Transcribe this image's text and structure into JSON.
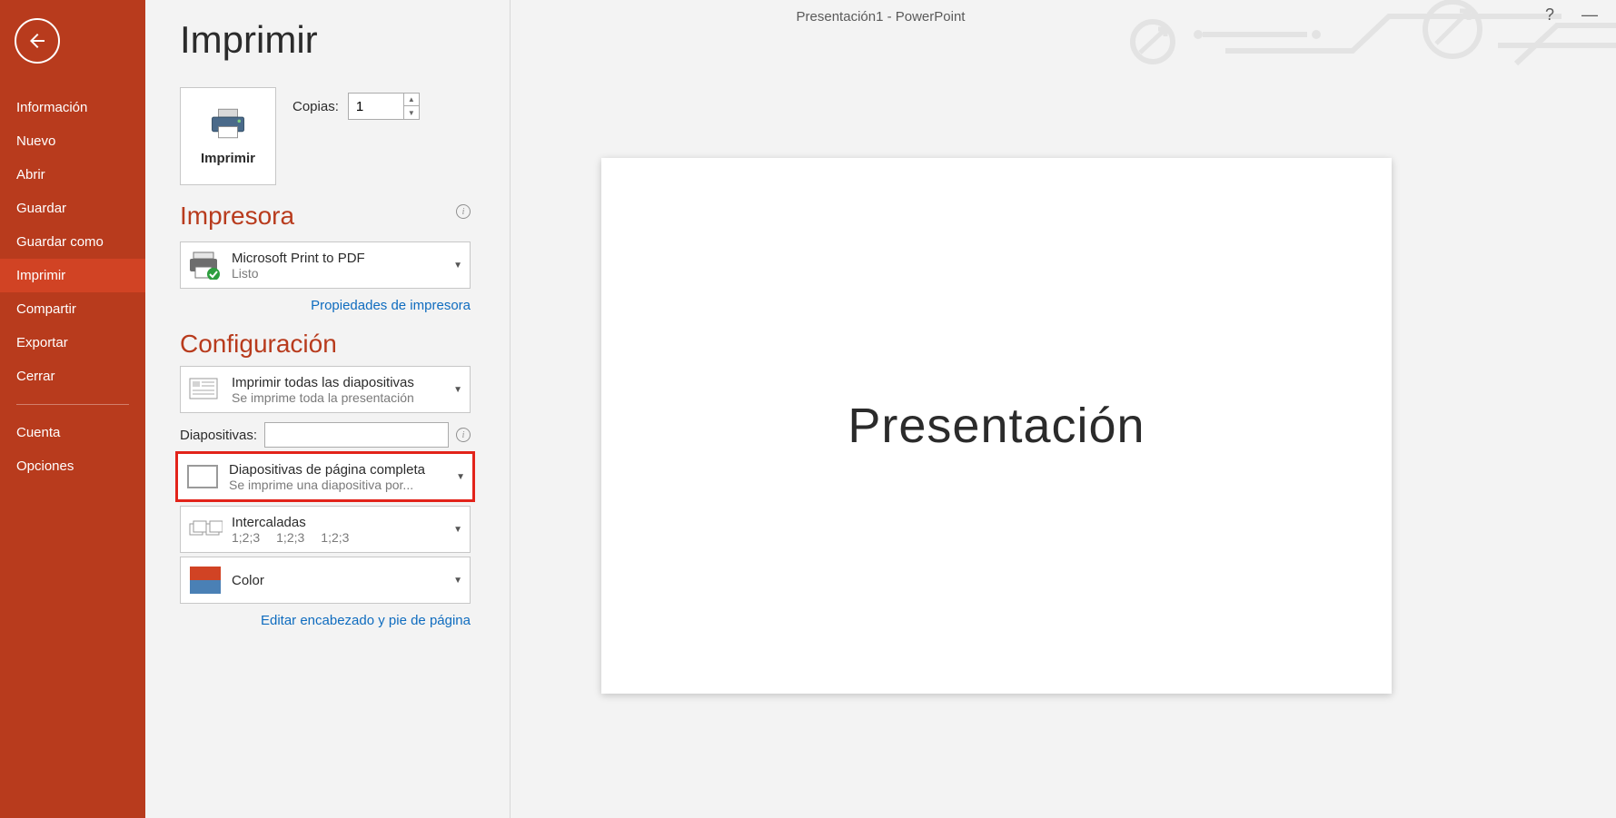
{
  "window": {
    "title": "Presentación1 - PowerPoint",
    "help": "?",
    "minimize": "—"
  },
  "sidebar": {
    "items": [
      {
        "label": "Información"
      },
      {
        "label": "Nuevo"
      },
      {
        "label": "Abrir"
      },
      {
        "label": "Guardar"
      },
      {
        "label": "Guardar como"
      },
      {
        "label": "Imprimir"
      },
      {
        "label": "Compartir"
      },
      {
        "label": "Exportar"
      },
      {
        "label": "Cerrar"
      }
    ],
    "footer": [
      {
        "label": "Cuenta"
      },
      {
        "label": "Opciones"
      }
    ]
  },
  "print": {
    "title": "Imprimir",
    "button_label": "Imprimir",
    "copies_label": "Copias:",
    "copies_value": "1",
    "printer_heading": "Impresora",
    "printer": {
      "name": "Microsoft Print to PDF",
      "status": "Listo"
    },
    "printer_props_link": "Propiedades de impresora",
    "config_heading": "Configuración",
    "all_slides": {
      "title": "Imprimir todas las diapositivas",
      "sub": "Se imprime toda la presentación"
    },
    "slides_label": "Diapositivas:",
    "slides_value": "",
    "layout": {
      "title": "Diapositivas de página completa",
      "sub": "Se imprime una diapositiva por..."
    },
    "collate": {
      "title": "Intercaladas",
      "sub1": "1;2;3",
      "sub2": "1;2;3",
      "sub3": "1;2;3"
    },
    "color": {
      "title": "Color"
    },
    "header_footer_link": "Editar encabezado y pie de página"
  },
  "preview": {
    "slide_title": "Presentación"
  }
}
